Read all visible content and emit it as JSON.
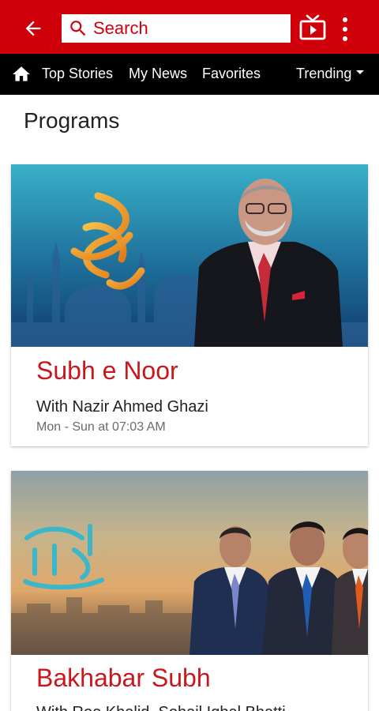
{
  "colors": {
    "accent": "#d0000b",
    "navbar": "#000000",
    "title_red": "#c8181e"
  },
  "header": {
    "back_icon": "arrow-left-icon",
    "search": {
      "placeholder": "Search",
      "value": "",
      "icon": "search-icon"
    },
    "tv_icon": "live-tv-icon",
    "menu_icon": "more-vert-icon"
  },
  "nav": {
    "home_icon": "home-icon",
    "items": [
      {
        "label": "Top Stories"
      },
      {
        "label": "My News"
      },
      {
        "label": "Favorites"
      },
      {
        "label": "Trending"
      }
    ]
  },
  "page": {
    "title": "Programs"
  },
  "programs": [
    {
      "title": "Subh e Noor",
      "host": "With Nazir Ahmed Ghazi",
      "schedule": "Mon - Sun at 07:03 AM",
      "logo_text": "صبحِ نور"
    },
    {
      "title": "Bakhabar Subh",
      "host": "With Ree Khalid, Sohail Iqbal Bhatti",
      "logo_text": "خبر یا صبح"
    }
  ]
}
